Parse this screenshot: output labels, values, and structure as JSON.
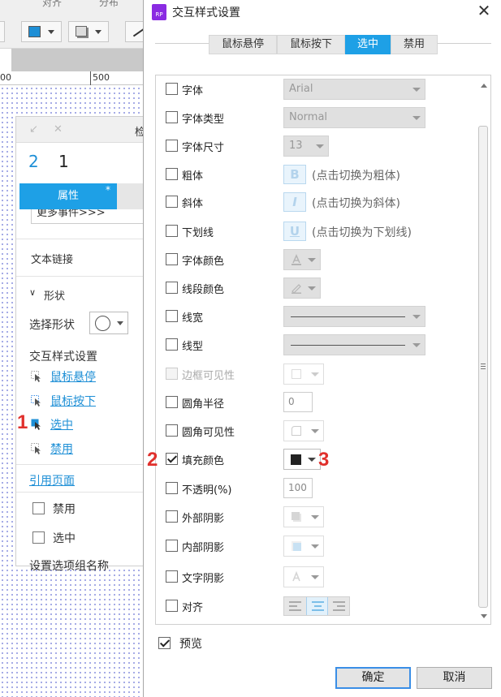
{
  "background": {
    "toolbar_left_text": "对齐",
    "toolbar_right_text": "分布",
    "ruler_left": "00",
    "ruler_mark": "500",
    "inspector": {
      "title": "检",
      "name_num": "2",
      "name_text": "1",
      "tab_label": "属性",
      "tab_star": "*",
      "events_box": "更多事件>>>",
      "text_link": "文本链接",
      "shape_section": "形状",
      "select_shape": "选择形状",
      "interaction_title": "交互样式设置",
      "links": [
        "鼠标悬停",
        "鼠标按下",
        "选中",
        "禁用"
      ],
      "ref_page": "引用页面",
      "checks": [
        "禁用",
        "选中"
      ],
      "bottom_text": "设置选项组名称"
    }
  },
  "markers": {
    "one": "1",
    "two": "2",
    "three": "3"
  },
  "dialog": {
    "title": "交互样式设置",
    "logo": "RP",
    "tabs": [
      {
        "label": "鼠标悬停",
        "active": false
      },
      {
        "label": "鼠标按下",
        "active": false
      },
      {
        "label": "选中",
        "active": true
      },
      {
        "label": "禁用",
        "active": false
      }
    ],
    "rows": {
      "font": {
        "label": "字体",
        "value": "Arial"
      },
      "font_type": {
        "label": "字体类型",
        "value": "Normal"
      },
      "font_size": {
        "label": "字体尺寸",
        "value": "13"
      },
      "bold": {
        "label": "粗体",
        "icon": "B",
        "hint": "(点击切换为粗体)"
      },
      "italic": {
        "label": "斜体",
        "icon": "I",
        "hint": "(点击切换为斜体)"
      },
      "underline": {
        "label": "下划线",
        "icon": "U",
        "hint": "(点击切换为下划线)"
      },
      "font_color": {
        "label": "字体颜色"
      },
      "line_color": {
        "label": "线段颜色"
      },
      "line_width": {
        "label": "线宽"
      },
      "line_type": {
        "label": "线型"
      },
      "border_visibility": {
        "label": "边框可见性"
      },
      "corner_radius": {
        "label": "圆角半径",
        "value": "0"
      },
      "corner_visibility": {
        "label": "圆角可见性"
      },
      "fill_color": {
        "label": "填充颜色",
        "checked": true,
        "swatch_color": "#222222"
      },
      "opacity": {
        "label": "不透明(%)",
        "value": "100"
      },
      "outer_shadow": {
        "label": "外部阴影"
      },
      "inner_shadow": {
        "label": "内部阴影"
      },
      "text_shadow": {
        "label": "文字阴影"
      },
      "alignment": {
        "label": "对齐"
      }
    },
    "preview_label": "预览",
    "ok_label": "确定",
    "cancel_label": "取消"
  },
  "colors": {
    "accent": "#1ea0e6",
    "marker_red": "#e0302c"
  }
}
